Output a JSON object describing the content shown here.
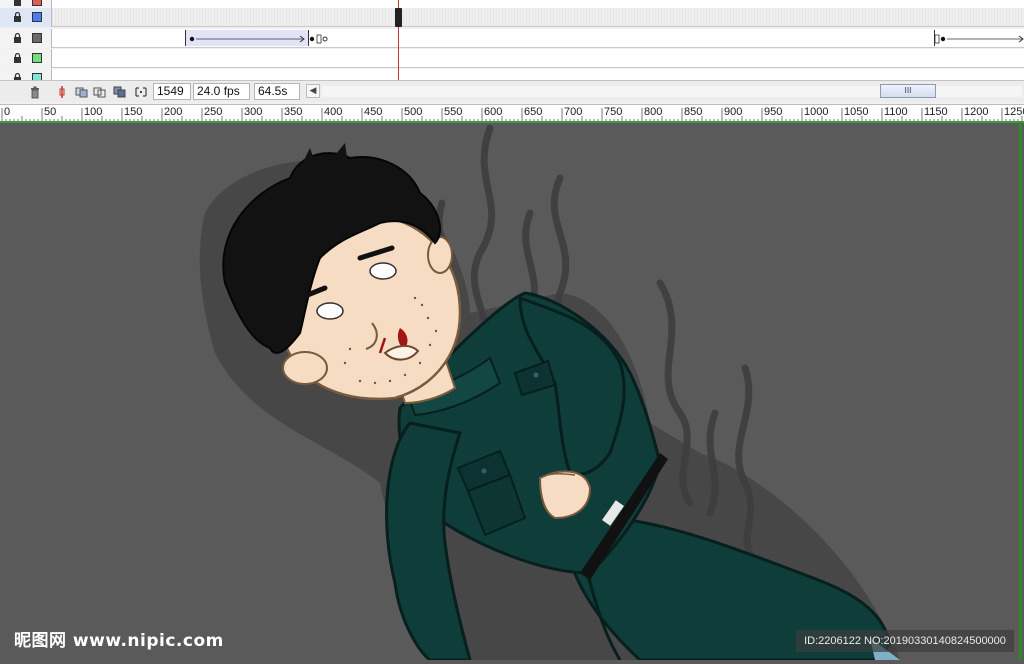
{
  "timeline": {
    "layers": [
      {
        "swatch_color": "#e05a5a",
        "selected": false,
        "frames_shaded": false
      },
      {
        "swatch_color": "#4a7ef0",
        "selected": true,
        "frames_shaded": true
      },
      {
        "swatch_color": "#6a6a6a",
        "selected": false,
        "frames_shaded": false
      },
      {
        "swatch_color": "#6fe07a",
        "selected": false,
        "frames_shaded": false
      },
      {
        "swatch_color": "#7fe6d6",
        "selected": false,
        "frames_shaded": false
      }
    ],
    "current_frame": "1549",
    "frame_rate": "24.0 fps",
    "elapsed_time": "64.5s"
  },
  "ruler": {
    "labels": [
      "0",
      "50",
      "100",
      "150",
      "200",
      "250",
      "300",
      "350",
      "400",
      "450",
      "500",
      "550",
      "600",
      "650",
      "700",
      "750",
      "800",
      "850",
      "900",
      "950",
      "1000",
      "1050",
      "1100",
      "1150",
      "1200",
      "1250"
    ]
  },
  "watermark": {
    "site": "昵图网 www.nipic.com",
    "id_text": "ID:2206122 NO:20190330140824500000"
  },
  "colors": {
    "stage_bg": "#5a5a5a",
    "uniform": "#0f3d3a",
    "hair": "#121212",
    "skin": "#f6dcc2"
  }
}
